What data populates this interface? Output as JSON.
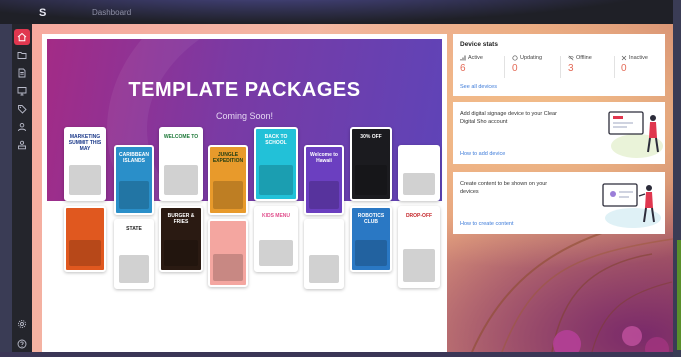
{
  "app": {
    "logo": "S",
    "breadcrumb": "Dashboard"
  },
  "sidebar": {
    "items": [
      {
        "name": "home-icon",
        "active": true
      },
      {
        "name": "folder-icon",
        "active": false
      },
      {
        "name": "document-icon",
        "active": false
      },
      {
        "name": "monitor-icon",
        "active": false
      },
      {
        "name": "tag-icon",
        "active": false
      },
      {
        "name": "users-icon",
        "active": false
      },
      {
        "name": "user-group-icon",
        "active": false
      },
      {
        "name": "gear-icon",
        "active": false
      },
      {
        "name": "help-icon",
        "active": false
      }
    ]
  },
  "promo": {
    "title": "TEMPLATE PACKAGES",
    "subtitle": "Coming Soon!",
    "templates_top": [
      {
        "label": "MARKETING SUMMIT THIS MAY",
        "color": "#ffffff",
        "text": "#1c3a8a"
      },
      {
        "label": "CARIBBEAN ISLANDS",
        "color": "#2a8fc9",
        "text": "#ffffff"
      },
      {
        "label": "WELCOME TO",
        "color": "#ffffff",
        "text": "#1f7a3a"
      },
      {
        "label": "JUNGLE EXPEDITION",
        "color": "#e89a2b",
        "text": "#1d3b12"
      },
      {
        "label": "BACK TO SCHOOL",
        "color": "#22c1d8",
        "text": "#ffffff"
      },
      {
        "label": "Welcome to Hawaii",
        "color": "#6b3fc0",
        "text": "#ffffff"
      },
      {
        "label": "30% OFF",
        "color": "#1b1b1f",
        "text": "#ffffff"
      },
      {
        "label": "",
        "color": "#ffffff",
        "text": "#222222"
      }
    ],
    "templates_bottom": [
      {
        "label": "",
        "color": "#e0581f",
        "text": "#ffffff"
      },
      {
        "label": "STATE",
        "color": "#ffffff",
        "text": "#222222"
      },
      {
        "label": "BURGER & FRIES",
        "color": "#2a1a12",
        "text": "#ffffff"
      },
      {
        "label": "",
        "color": "#f4a6a0",
        "text": "#ffffff"
      },
      {
        "label": "KIDS MENU",
        "color": "#ffffff",
        "text": "#e04f8c"
      },
      {
        "label": "",
        "color": "#ffffff",
        "text": "#222222"
      },
      {
        "label": "ROBOTICS CLUB",
        "color": "#2a78c4",
        "text": "#ffffff"
      },
      {
        "label": "DROP-OFF",
        "color": "#ffffff",
        "text": "#c4262a"
      }
    ]
  },
  "stats": {
    "title": "Device stats",
    "items": [
      {
        "label": "Active",
        "value": "6",
        "icon": "signal-icon"
      },
      {
        "label": "Updating",
        "value": "0",
        "icon": "refresh-icon"
      },
      {
        "label": "Offline",
        "value": "3",
        "icon": "wifi-off-icon"
      },
      {
        "label": "Inactive",
        "value": "0",
        "icon": "close-icon"
      }
    ],
    "link": "See all devices"
  },
  "add_device": {
    "description": "Add digital signage device to your Clear Digital Sho account",
    "link": "How to add device"
  },
  "create_content": {
    "description": "Create content to be shown on your devices",
    "link": "How to create content"
  },
  "colors": {
    "accent": "#e0374f",
    "stat_number": "#e36a57",
    "link": "#3d7bd9"
  }
}
